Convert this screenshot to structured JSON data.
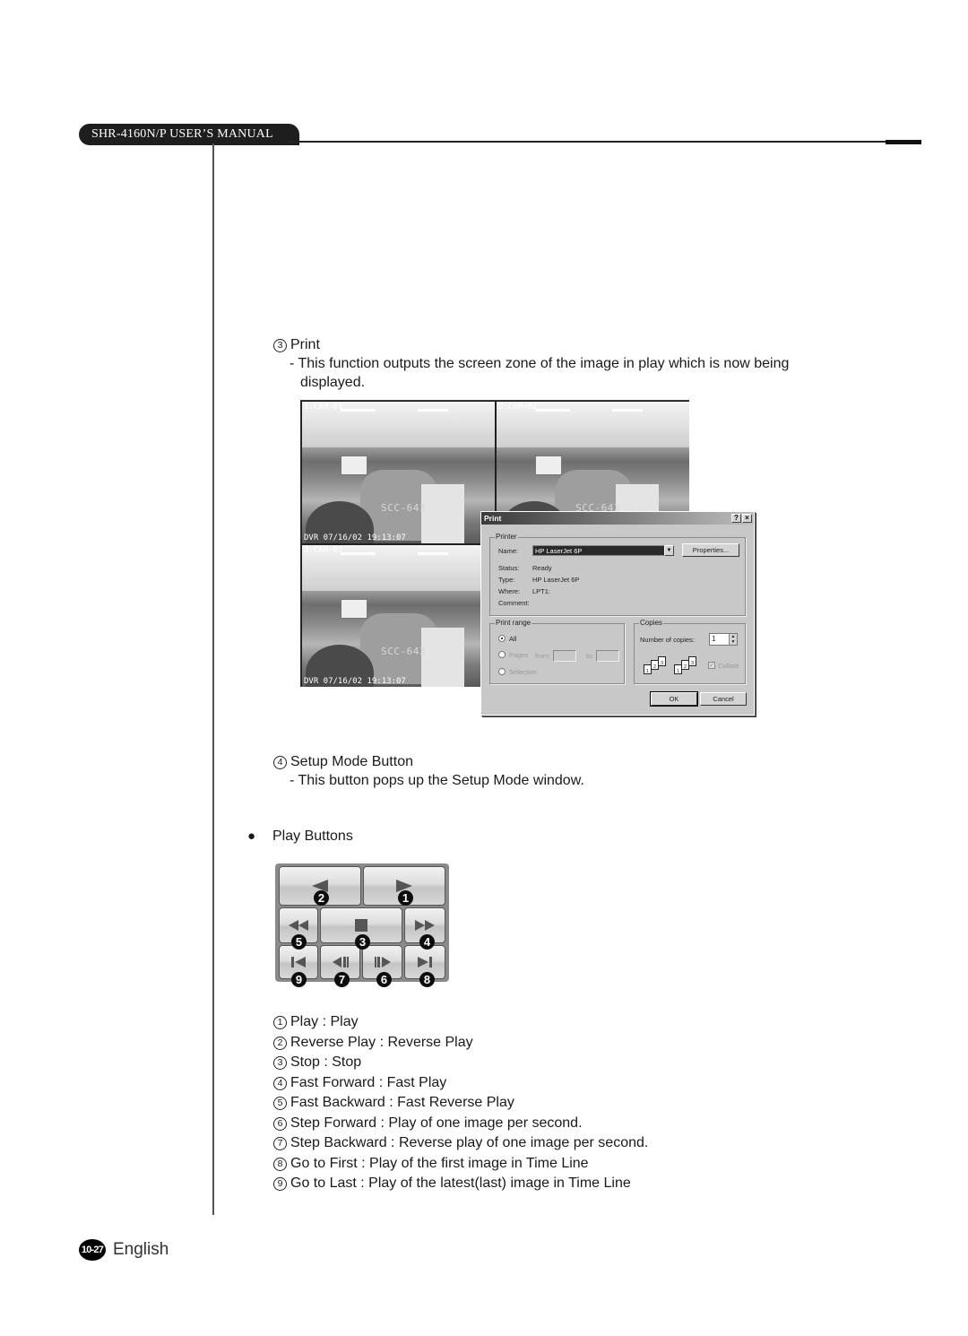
{
  "header": {
    "manual_title": "SHR-4160N/P USER’S MANUAL"
  },
  "sections": {
    "print": {
      "number": "3",
      "title": "Print",
      "desc_line1": "- This function outputs the screen zone of the image in play which is now being",
      "desc_line2": "displayed."
    },
    "setup": {
      "number": "4",
      "title": "Setup Mode Button",
      "desc": "- This button pops up the Setup Mode window."
    },
    "play": {
      "bullet": "●",
      "title": "Play Buttons"
    }
  },
  "camera_view": {
    "cams": [
      {
        "top_label": "1:CAM-01",
        "bottom_label": "DVR 07/16/02 19:13:07",
        "model": "SCC-643"
      },
      {
        "top_label": "2:CAM-02",
        "bottom_label": "",
        "model": "SCC-643"
      },
      {
        "top_label": "3:CAM-03",
        "bottom_label": "DVR 07/16/02 19:13:07",
        "model": "SCC-643"
      }
    ]
  },
  "print_dialog": {
    "title": "Print",
    "help_btn": "?",
    "close_btn": "×",
    "printer_group": "Printer",
    "name_label": "Name:",
    "name_value": "HP LaserJet 6P",
    "properties_btn": "Properties...",
    "status_label": "Status:",
    "status_value": "Ready",
    "type_label": "Type:",
    "type_value": "HP LaserJet 6P",
    "where_label": "Where:",
    "where_value": "LPT1:",
    "comment_label": "Comment:",
    "range_group": "Print range",
    "range_all": "All",
    "range_pages": "Pages",
    "range_from": "from:",
    "range_to": "to:",
    "range_selection": "Selection",
    "copies_group": "Copies",
    "copies_label": "Number of copies:",
    "copies_value": "1",
    "collate_label": "Collate",
    "ok_btn": "OK",
    "cancel_btn": "Cancel"
  },
  "play_panel": {
    "callouts": [
      "2",
      "1",
      "5",
      "3",
      "4",
      "9",
      "7",
      "6",
      "8"
    ]
  },
  "legend": [
    {
      "num": "1",
      "text": "Play : Play"
    },
    {
      "num": "2",
      "text": "Reverse Play : Reverse Play"
    },
    {
      "num": "3",
      "text": "Stop : Stop"
    },
    {
      "num": "4",
      "text": "Fast Forward : Fast Play"
    },
    {
      "num": "5",
      "text": "Fast Backward : Fast Reverse Play"
    },
    {
      "num": "6",
      "text": "Step Forward : Play of one image per second."
    },
    {
      "num": "7",
      "text": "Step Backward : Reverse play of one image per second."
    },
    {
      "num": "8",
      "text": "Go to First : Play of the first image in Time Line"
    },
    {
      "num": "9",
      "text": "Go to Last : Play of the latest(last) image in Time Line"
    }
  ],
  "footer": {
    "page": "10-27",
    "language": "English"
  }
}
